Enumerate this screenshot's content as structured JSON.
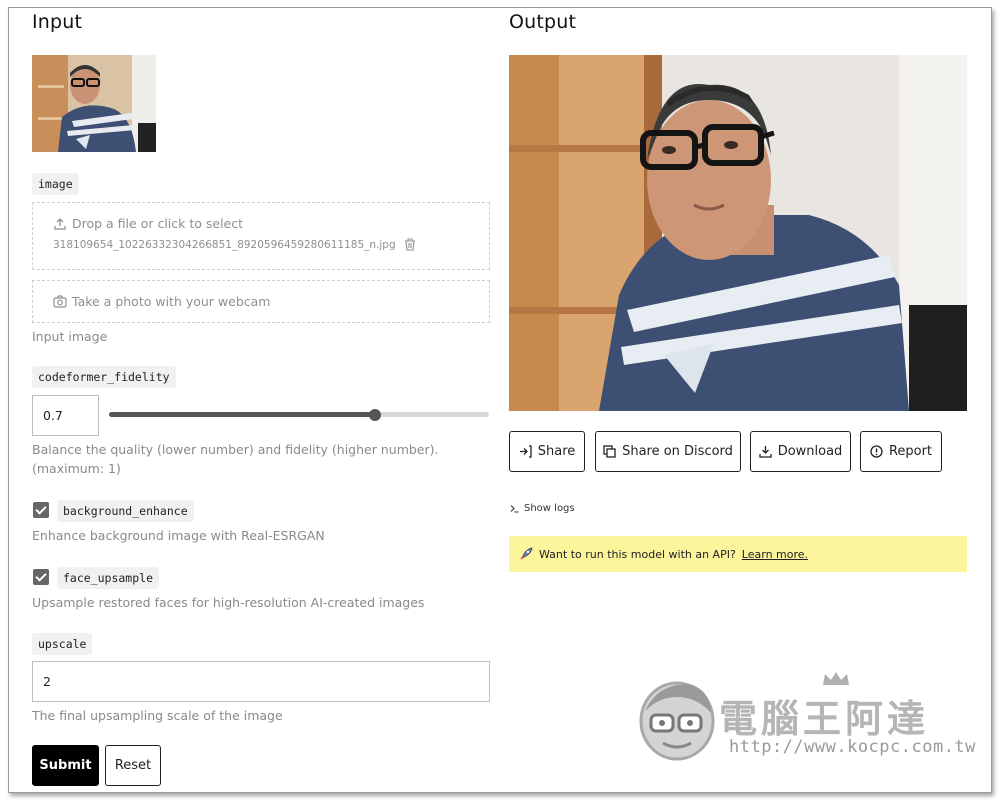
{
  "input": {
    "heading": "Input",
    "image_field": {
      "tag": "image",
      "drop_label": "Drop a file or click to select",
      "filename": "318109654_10226332304266851_8920596459280611185_n.jpg",
      "webcam_label": "Take a photo with your webcam",
      "hint": "Input image"
    },
    "fidelity": {
      "tag": "codeformer_fidelity",
      "value": "0.7",
      "slider_fraction": 0.7,
      "hint_line1": "Balance the quality (lower number) and fidelity (higher number).",
      "hint_line2": "(maximum: 1)"
    },
    "background_enhance": {
      "tag": "background_enhance",
      "checked": true,
      "hint": "Enhance background image with Real-ESRGAN"
    },
    "face_upsample": {
      "tag": "face_upsample",
      "checked": true,
      "hint": "Upsample restored faces for high-resolution AI-created images"
    },
    "upscale": {
      "tag": "upscale",
      "value": "2",
      "hint": "The final upsampling scale of the image"
    },
    "submit_label": "Submit",
    "reset_label": "Reset"
  },
  "output": {
    "heading": "Output",
    "buttons": {
      "share": "Share",
      "discord": "Share on Discord",
      "download": "Download",
      "report": "Report"
    },
    "show_logs": "Show logs",
    "api_notice": "Want to run this model with an API?",
    "api_link": "Learn more."
  },
  "watermark": {
    "chinese": "電腦王阿達",
    "url": "http://www.kocpc.com.tw"
  },
  "colors": {
    "notice_bg": "#fdf59c",
    "submit_bg": "#000000",
    "shirt_navy": "#3d4f72"
  }
}
